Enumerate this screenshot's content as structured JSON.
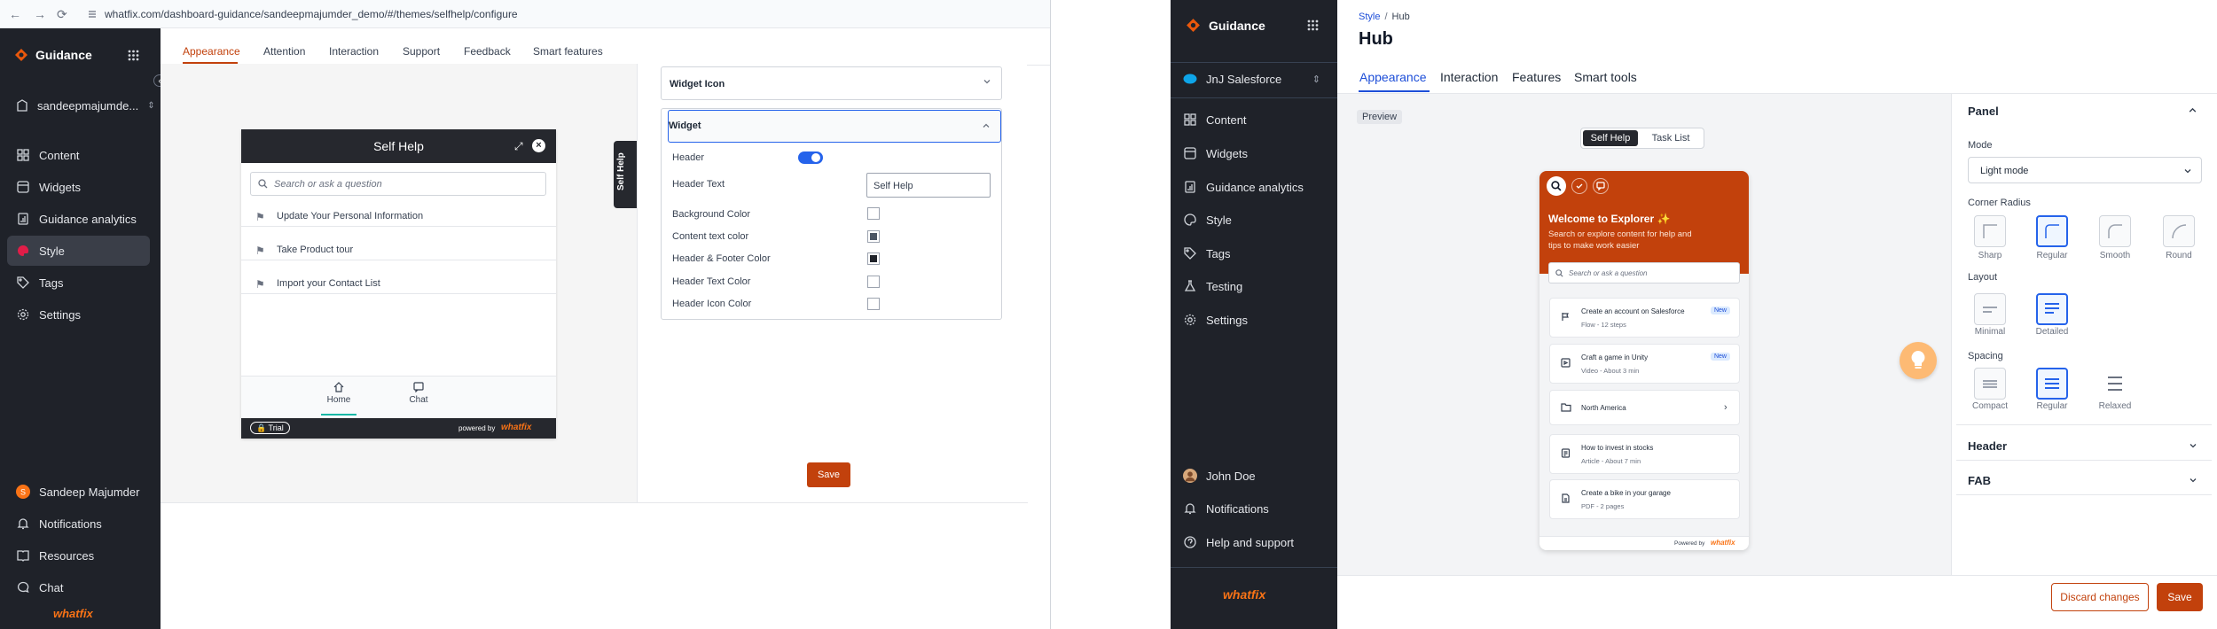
{
  "left_window": {
    "browser": {
      "back": "←",
      "forward": "→",
      "reload": "⟳",
      "url": "whatfix.com/dashboard-guidance/sandeepmajumder_demo/#/themes/selfhelp/configure"
    },
    "sidebar": {
      "brand": "Guidance",
      "account": "sandeepmajumde...",
      "items": [
        {
          "label": "Content",
          "icon": "grid-icon"
        },
        {
          "label": "Widgets",
          "icon": "widget-icon"
        },
        {
          "label": "Guidance analytics",
          "icon": "analytics-icon"
        },
        {
          "label": "Style",
          "icon": "palette-icon"
        },
        {
          "label": "Tags",
          "icon": "tag-icon"
        },
        {
          "label": "Settings",
          "icon": "gear-icon"
        }
      ],
      "bottom": [
        {
          "label": "Sandeep Majumder",
          "icon": "avatar"
        },
        {
          "label": "Notifications",
          "icon": "bell-icon"
        },
        {
          "label": "Resources",
          "icon": "book-icon"
        },
        {
          "label": "Chat",
          "icon": "chat-icon"
        }
      ],
      "footer_logo": "whatfix"
    },
    "tabs": [
      "Appearance",
      "Attention",
      "Interaction",
      "Support",
      "Feedback",
      "Smart features"
    ],
    "preview": {
      "title": "Self Help",
      "search_placeholder": "Search or ask a question",
      "items": [
        "Update Your Personal Information",
        "Take Product tour",
        "Import your Contact List"
      ],
      "nav": [
        "Home",
        "Chat"
      ],
      "trial": "Trial",
      "powered": "powered by",
      "powered_logo": "whatfix",
      "side_tab": "Self Help"
    },
    "settings": {
      "widget_icon": "Widget Icon",
      "widget": "Widget",
      "rows": [
        "Header",
        "Header Text",
        "Background Color",
        "Content text color",
        "Header & Footer Color",
        "Header Text Color",
        "Header Icon Color"
      ],
      "header_text_value": "Self Help",
      "save": "Save"
    }
  },
  "right_window": {
    "sidebar": {
      "brand": "Guidance",
      "account": "JnJ Salesforce",
      "items": [
        "Content",
        "Widgets",
        "Guidance analytics",
        "Style",
        "Tags",
        "Testing",
        "Settings"
      ],
      "bottom": [
        "John Doe",
        "Notifications",
        "Help and support"
      ],
      "footer_logo": "whatfix"
    },
    "breadcrumb": {
      "parent": "Style",
      "sep": "/",
      "current": "Hub"
    },
    "page_title": "Hub",
    "tabs": [
      "Appearance",
      "Interaction",
      "Features",
      "Smart tools"
    ],
    "preview_badge": "Preview",
    "toggle": [
      "Self Help",
      "Task List"
    ],
    "widget": {
      "welcome": "Welcome to Explorer ✨",
      "subtitle_1": "Search or explore content for help and",
      "subtitle_2": "tips to make work easier",
      "search_placeholder": "Search or ask a question",
      "cards": [
        {
          "title": "Create an account on Salesforce",
          "sub": "Flow - 12 steps",
          "new": "New"
        },
        {
          "title": "Craft a game in Unity",
          "sub": "Video - About 3 min",
          "new": "New"
        },
        {
          "title": "North America",
          "sub": "",
          "new": ""
        },
        {
          "title": "How to invest in stocks",
          "sub": "Article - About 7 min",
          "new": ""
        },
        {
          "title": "Create a bike in your garage",
          "sub": "PDF - 2 pages",
          "new": ""
        }
      ],
      "powered": "Powered by",
      "powered_logo": "whatfix"
    },
    "panel": {
      "title": "Panel",
      "mode_label": "Mode",
      "mode_value": "Light mode",
      "corner_label": "Corner Radius",
      "corner_options": [
        "Sharp",
        "Regular",
        "Smooth",
        "Round"
      ],
      "layout_label": "Layout",
      "layout_options": [
        "Minimal",
        "Detailed"
      ],
      "spacing_label": "Spacing",
      "spacing_options": [
        "Compact",
        "Regular",
        "Relaxed"
      ],
      "header_section": "Header",
      "fab_section": "FAB"
    },
    "footer": {
      "discard": "Discard changes",
      "save": "Save"
    }
  },
  "colors": {
    "brand_orange": "#c2410c",
    "sidebar_bg": "#1f2229",
    "accent_blue": "#2563eb",
    "widget_header": "#c2410c"
  }
}
